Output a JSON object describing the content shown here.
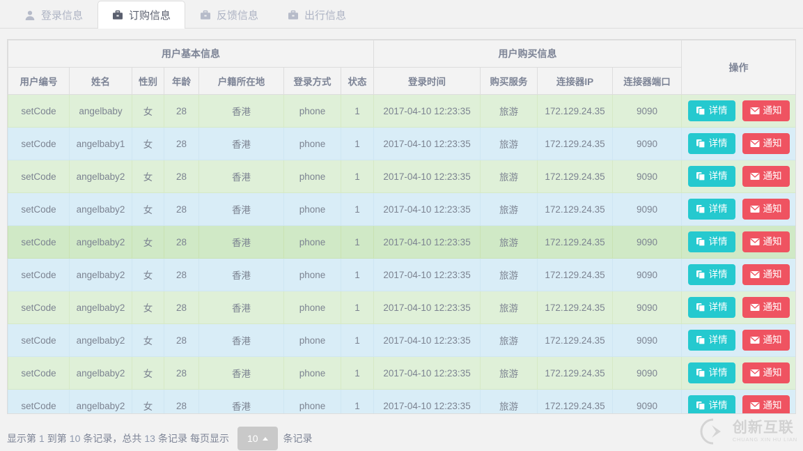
{
  "tabs": [
    {
      "label": "登录信息",
      "icon": "user-icon",
      "active": false
    },
    {
      "label": "订购信息",
      "icon": "briefcase-icon",
      "active": true
    },
    {
      "label": "反馈信息",
      "icon": "briefcase-icon",
      "active": false
    },
    {
      "label": "出行信息",
      "icon": "briefcase-icon",
      "active": false
    }
  ],
  "table": {
    "group_headers": [
      {
        "label": "用户基本信息",
        "colspan": 7
      },
      {
        "label": "用户购买信息",
        "colspan": 4
      },
      {
        "label": "操作",
        "colspan": 1,
        "rowspan": 2
      }
    ],
    "columns": [
      "用户编号",
      "姓名",
      "性别",
      "年龄",
      "户籍所在地",
      "登录方式",
      "状态",
      "登录时间",
      "购买服务",
      "连接器IP",
      "连接器端口"
    ],
    "rows": [
      {
        "style": "green",
        "cells": [
          "setCode",
          "angelbaby",
          "女",
          "28",
          "香港",
          "phone",
          "1",
          "2017-04-10 12:23:35",
          "旅游",
          "172.129.24.35",
          "9090"
        ]
      },
      {
        "style": "blue",
        "cells": [
          "setCode",
          "angelbaby1",
          "女",
          "28",
          "香港",
          "phone",
          "1",
          "2017-04-10 12:23:35",
          "旅游",
          "172.129.24.35",
          "9090"
        ]
      },
      {
        "style": "green",
        "cells": [
          "setCode",
          "angelbaby2",
          "女",
          "28",
          "香港",
          "phone",
          "1",
          "2017-04-10 12:23:35",
          "旅游",
          "172.129.24.35",
          "9090"
        ]
      },
      {
        "style": "blue",
        "cells": [
          "setCode",
          "angelbaby2",
          "女",
          "28",
          "香港",
          "phone",
          "1",
          "2017-04-10 12:23:35",
          "旅游",
          "172.129.24.35",
          "9090"
        ]
      },
      {
        "style": "green hover",
        "cells": [
          "setCode",
          "angelbaby2",
          "女",
          "28",
          "香港",
          "phone",
          "1",
          "2017-04-10 12:23:35",
          "旅游",
          "172.129.24.35",
          "9090"
        ]
      },
      {
        "style": "blue",
        "cells": [
          "setCode",
          "angelbaby2",
          "女",
          "28",
          "香港",
          "phone",
          "1",
          "2017-04-10 12:23:35",
          "旅游",
          "172.129.24.35",
          "9090"
        ]
      },
      {
        "style": "green",
        "cells": [
          "setCode",
          "angelbaby2",
          "女",
          "28",
          "香港",
          "phone",
          "1",
          "2017-04-10 12:23:35",
          "旅游",
          "172.129.24.35",
          "9090"
        ]
      },
      {
        "style": "blue",
        "cells": [
          "setCode",
          "angelbaby2",
          "女",
          "28",
          "香港",
          "phone",
          "1",
          "2017-04-10 12:23:35",
          "旅游",
          "172.129.24.35",
          "9090"
        ]
      },
      {
        "style": "green",
        "cells": [
          "setCode",
          "angelbaby2",
          "女",
          "28",
          "香港",
          "phone",
          "1",
          "2017-04-10 12:23:35",
          "旅游",
          "172.129.24.35",
          "9090"
        ]
      },
      {
        "style": "blue",
        "cells": [
          "setCode",
          "angelbaby2",
          "女",
          "28",
          "香港",
          "phone",
          "1",
          "2017-04-10 12:23:35",
          "旅游",
          "172.129.24.35",
          "9090"
        ]
      }
    ],
    "actions": {
      "detail_label": "详情",
      "detail_icon": "copy-files-icon",
      "detail_color": "#25c9cf",
      "notify_label": "通知",
      "notify_icon": "envelope-icon",
      "notify_color": "#ef5361"
    }
  },
  "footer": {
    "prefix": "显示第",
    "from": "1",
    "middle": "到第",
    "to": "10",
    "records_word": "条记录，总共",
    "total": "13",
    "records_word2": "条记录",
    "page_size_label": "每页显示",
    "page_size_value": "10",
    "suffix": "条记录"
  },
  "watermark": {
    "cn": "创新互联",
    "en": "CHUANG XIN HU LIAN",
    "mark": "cx-logo-icon"
  }
}
